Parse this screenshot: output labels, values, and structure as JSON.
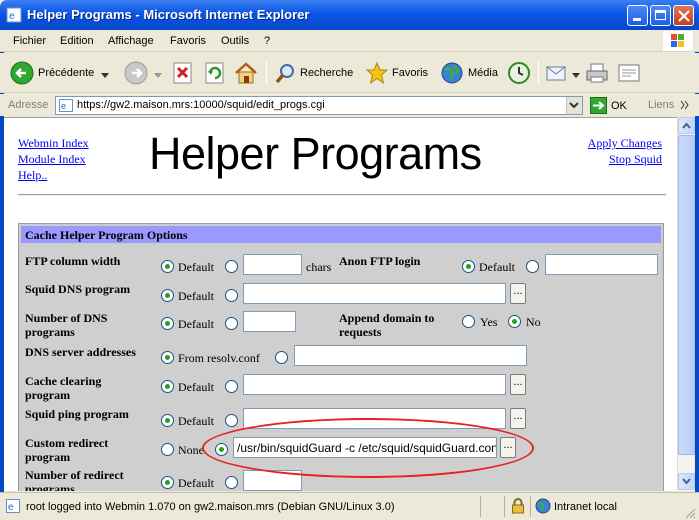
{
  "window": {
    "title": "Helper Programs - Microsoft Internet Explorer"
  },
  "menu": [
    "Fichier",
    "Edition",
    "Affichage",
    "Favoris",
    "Outils",
    "?"
  ],
  "toolbar": {
    "back": "Précédente",
    "search": "Recherche",
    "favorites": "Favoris",
    "media": "Média"
  },
  "address": {
    "label": "Adresse",
    "url": "https://gw2.maison.mrs:10000/squid/edit_progs.cgi",
    "go": "OK",
    "links": "Liens"
  },
  "page": {
    "title": "Helper Programs",
    "left_links": [
      "Webmin Index",
      "Module Index",
      "Help.."
    ],
    "right_links": [
      "Apply Changes",
      "Stop Squid"
    ],
    "section_title": "Cache Helper Program Options",
    "fields": {
      "ftp_col": {
        "label": "FTP column width",
        "default": "Default",
        "suffix": "chars"
      },
      "anon_ftp": {
        "label": "Anon FTP login",
        "default": "Default"
      },
      "dns_prog": {
        "label": "Squid DNS program",
        "default": "Default"
      },
      "num_dns": {
        "label1": "Number of DNS",
        "label2": "programs",
        "default": "Default"
      },
      "append": {
        "label1": "Append domain to",
        "label2": "requests",
        "yes": "Yes",
        "no": "No"
      },
      "dns_servers": {
        "label": "DNS server addresses",
        "option": "From resolv.conf"
      },
      "cache_clear": {
        "label1": "Cache clearing",
        "label2": "program",
        "default": "Default"
      },
      "ping": {
        "label": "Squid ping program",
        "default": "Default"
      },
      "redirect": {
        "label1": "Custom redirect",
        "label2": "program",
        "none": "None",
        "value": "/usr/bin/squidGuard -c /etc/squid/squidGuard.conf"
      },
      "num_redirect": {
        "label1": "Number of redirect",
        "label2": "programs",
        "default": "Default"
      }
    },
    "browse_button": "..."
  },
  "status": {
    "text": "root logged into Webmin 1.070 on gw2.maison.mrs (Debian GNU/Linux 3.0)",
    "zone": "Intranet local"
  },
  "colors": {
    "title_bar": "#0a56e6",
    "section_header": "#9999ff",
    "panel": "#cccccc",
    "highlight": "#e82020"
  }
}
